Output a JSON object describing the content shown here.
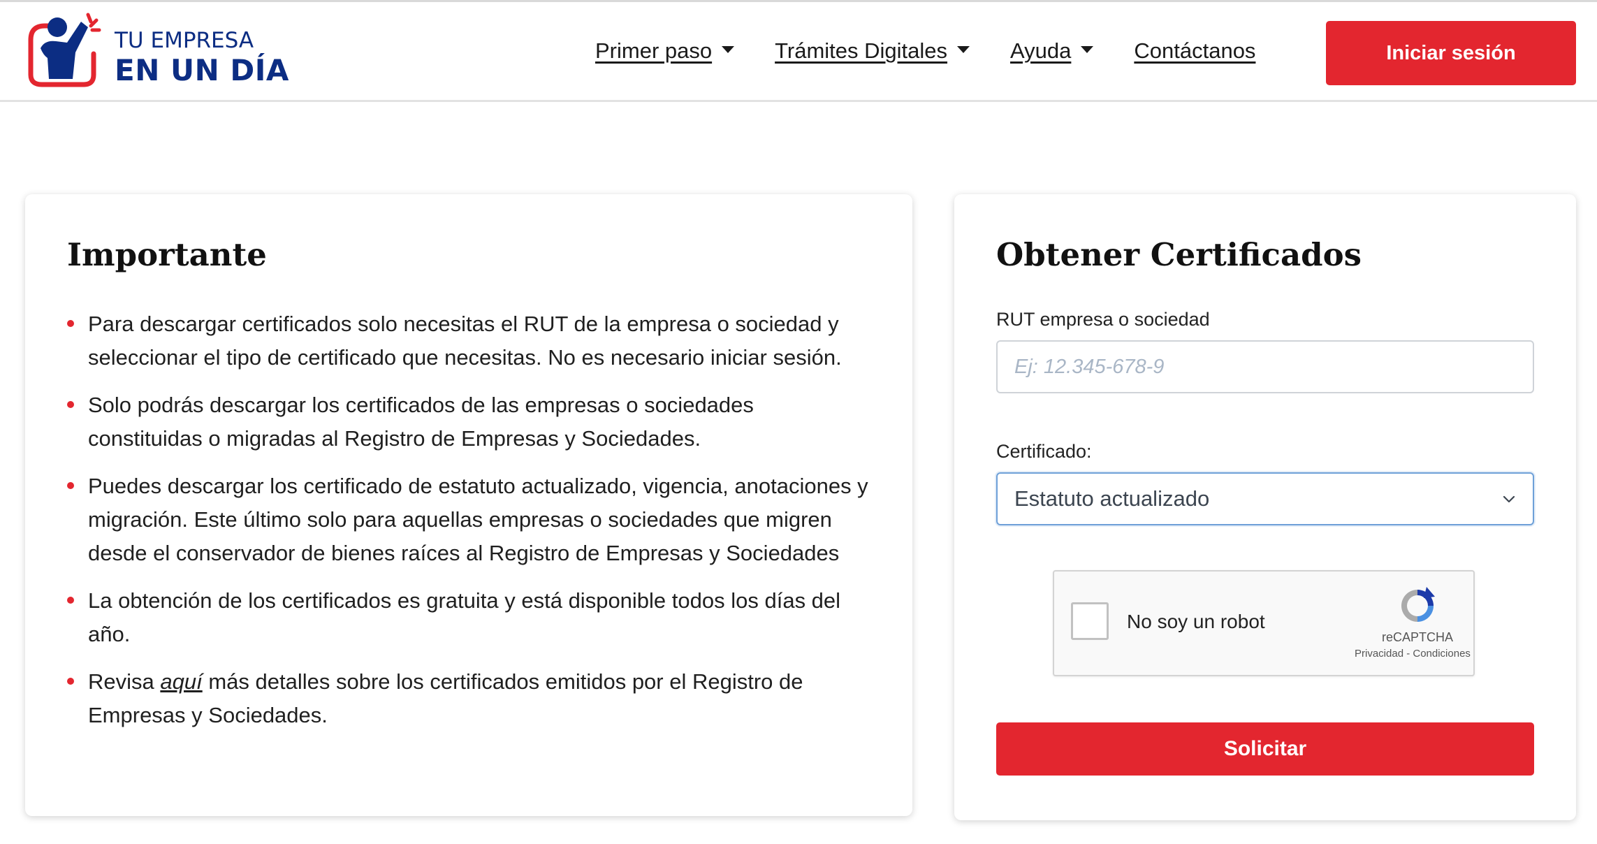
{
  "header": {
    "logo": {
      "line1": "TU EMPRESA",
      "line2": "EN UN DÍA"
    },
    "nav": [
      {
        "label": "Primer paso",
        "has_dropdown": true
      },
      {
        "label": "Trámites Digitales",
        "has_dropdown": true
      },
      {
        "label": "Ayuda",
        "has_dropdown": true
      },
      {
        "label": "Contáctanos",
        "has_dropdown": false
      }
    ],
    "login_label": "Iniciar sesión"
  },
  "important": {
    "title": "Importante",
    "items": [
      "Para descargar certificados solo necesitas el RUT de la empresa o sociedad y seleccionar el tipo de certificado que necesitas. No es necesario iniciar sesión.",
      "Solo podrás descargar los certificados de las empresas o sociedades constituidas o migradas al Registro de Empresas y Sociedades.",
      "Puedes descargar los certificado de estatuto actualizado, vigencia, anotaciones y migración. Este último solo para aquellas empresas o sociedades que migren desde el conservador de bienes raíces al Registro de Empresas y Sociedades",
      "La obtención de los certificados es gratuita y está disponible todos los días del año."
    ],
    "last_item": {
      "prefix": "Revisa ",
      "link": "aquí",
      "suffix": " más detalles sobre los certificados emitidos por el Registro de Empresas y Sociedades."
    }
  },
  "form": {
    "title": "Obtener Certificados",
    "rut_label": "RUT empresa o sociedad",
    "rut_value": "",
    "rut_placeholder": "Ej: 12.345-678-9",
    "cert_label": "Certificado:",
    "cert_selected": "Estatuto actualizado",
    "recaptcha": {
      "label": "No soy un robot",
      "brand": "reCAPTCHA",
      "terms": "Privacidad - Condiciones"
    },
    "submit_label": "Solicitar"
  },
  "colors": {
    "accent": "#e3262f",
    "brand_blue": "#0c2d83",
    "focus_blue": "#6ea0d8"
  }
}
